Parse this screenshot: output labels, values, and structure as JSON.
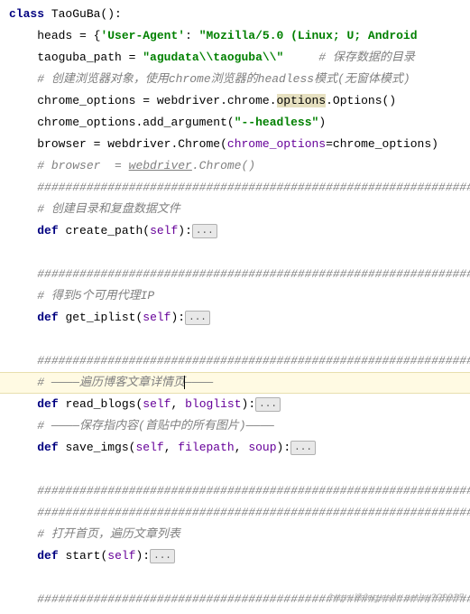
{
  "code": {
    "lines": [
      {
        "indent": 0,
        "type": "class-decl",
        "kw": "class",
        "name": "TaoGuBa",
        "paren": "()",
        "colon": ":"
      },
      {
        "indent": 1,
        "type": "assign",
        "lhs": "heads",
        "eq": " = ",
        "rhs_parts": [
          {
            "t": "op",
            "v": "{"
          },
          {
            "t": "str",
            "v": "'User-Agent'"
          },
          {
            "t": "op",
            "v": ": "
          },
          {
            "t": "str",
            "v": "\"Mozilla/5.0 (Linux; U; Android"
          }
        ]
      },
      {
        "indent": 1,
        "type": "assign",
        "lhs": "taoguba_path",
        "eq": " = ",
        "rhs_parts": [
          {
            "t": "str",
            "v": "\"agudata\\\\taoguba\\\\\""
          }
        ],
        "trail_cmt": "     # 保存数据的目录"
      },
      {
        "indent": 1,
        "type": "comment",
        "text": "# 创建浏览器对象，使用",
        "italic": "chrome",
        "text2": "浏览器的",
        "italic2": "headless",
        "text3": "模式(无窗体模式)"
      },
      {
        "indent": 1,
        "type": "assign",
        "lhs": "chrome_options",
        "eq": " = ",
        "rhs_parts": [
          {
            "t": "id",
            "v": "webdriver"
          },
          {
            "t": "op",
            "v": "."
          },
          {
            "t": "id",
            "v": "chrome"
          },
          {
            "t": "op",
            "v": "."
          },
          {
            "t": "hl",
            "v": "options"
          },
          {
            "t": "op",
            "v": "."
          },
          {
            "t": "id",
            "v": "Options"
          },
          {
            "t": "op",
            "v": "()"
          }
        ]
      },
      {
        "indent": 1,
        "type": "call",
        "parts": [
          {
            "t": "id",
            "v": "chrome_options"
          },
          {
            "t": "op",
            "v": "."
          },
          {
            "t": "id",
            "v": "add_argument"
          },
          {
            "t": "op",
            "v": "("
          },
          {
            "t": "str",
            "v": "\"--headless\""
          },
          {
            "t": "op",
            "v": ")"
          }
        ]
      },
      {
        "indent": 1,
        "type": "assign",
        "lhs": "browser",
        "eq": " = ",
        "rhs_parts": [
          {
            "t": "id",
            "v": "webdriver"
          },
          {
            "t": "op",
            "v": "."
          },
          {
            "t": "id",
            "v": "Chrome"
          },
          {
            "t": "op",
            "v": "("
          },
          {
            "t": "param",
            "v": "chrome_options"
          },
          {
            "t": "op",
            "v": "="
          },
          {
            "t": "id",
            "v": "chrome_options"
          },
          {
            "t": "op",
            "v": ")"
          }
        ]
      },
      {
        "indent": 1,
        "type": "comment-full",
        "text": "# browser  = ",
        "under": "webdriver",
        "text2": ".Chrome()"
      },
      {
        "indent": 1,
        "type": "hashline",
        "text": "##############################################################"
      },
      {
        "indent": 1,
        "type": "comment-plain",
        "text": "# 创建目录和复盘数据文件"
      },
      {
        "indent": 1,
        "type": "def",
        "kw": "def",
        "name": "create_path",
        "params": [
          "self"
        ],
        "fold": "..."
      },
      {
        "indent": 1,
        "type": "blank"
      },
      {
        "indent": 1,
        "type": "hashline",
        "text": "##############################################################"
      },
      {
        "indent": 1,
        "type": "comment-plain",
        "text": "# 得到5个可用代理",
        "italic": "IP"
      },
      {
        "indent": 1,
        "type": "def",
        "kw": "def",
        "name": "get_iplist",
        "params": [
          "self"
        ],
        "fold": "..."
      },
      {
        "indent": 1,
        "type": "blank"
      },
      {
        "indent": 1,
        "type": "hashline",
        "text": "##############################################################"
      },
      {
        "indent": 1,
        "type": "comment-plain",
        "text": "# ————遍历博客文章详情页————",
        "caret_after": "# ————遍历博客文章详情页",
        "highlight": true
      },
      {
        "indent": 1,
        "type": "def",
        "kw": "def",
        "name": "read_blogs",
        "params": [
          "self",
          "bloglist"
        ],
        "fold": "..."
      },
      {
        "indent": 1,
        "type": "comment-plain",
        "text": "# ————保存指内容(首贴中的所有图片)————"
      },
      {
        "indent": 1,
        "type": "def",
        "kw": "def",
        "name": "save_imgs",
        "params": [
          "self",
          "filepath",
          "soup"
        ],
        "fold": "..."
      },
      {
        "indent": 1,
        "type": "blank"
      },
      {
        "indent": 1,
        "type": "hashline",
        "text": "##############################################################"
      },
      {
        "indent": 1,
        "type": "hashline",
        "text": "##############################################################"
      },
      {
        "indent": 1,
        "type": "comment-plain",
        "text": "# 打开首页，遍历文章列表"
      },
      {
        "indent": 1,
        "type": "def",
        "kw": "def",
        "name": "start",
        "params": [
          "self"
        ],
        "fold": "..."
      },
      {
        "indent": 1,
        "type": "blank"
      },
      {
        "indent": 1,
        "type": "hashline",
        "text": "##############################################################"
      }
    ]
  },
  "watermark": "https://blog.csdn.net/xy229935"
}
